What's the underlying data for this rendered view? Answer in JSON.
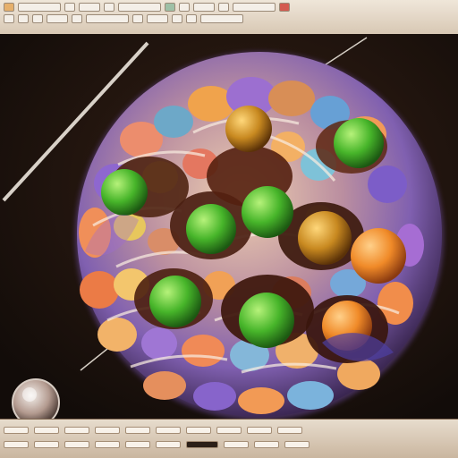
{
  "app": {
    "window_title": ""
  },
  "ui": {
    "accent_colors": [
      "#e6b06c",
      "#9ec0a6",
      "#d45a4f",
      "#7f5bc0"
    ],
    "toolbar_icons": [
      "app-icon",
      "file-icon",
      "edit-icon",
      "view-icon",
      "render-icon",
      "settings-icon",
      "help-icon",
      "close-icon"
    ],
    "scene_objects": [
      "porous-sphere",
      "green-ball",
      "orange-ball",
      "purple-shell"
    ],
    "status_indicators": [
      "left-panel",
      "bottom-status",
      "cursor-orb"
    ]
  }
}
